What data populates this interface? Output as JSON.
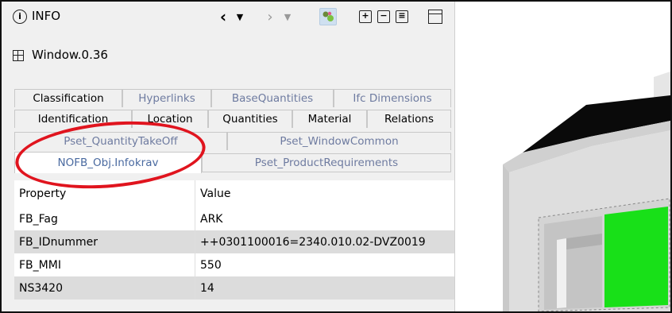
{
  "panel": {
    "title": "INFO",
    "info_icon_glyph": "i",
    "object_name": "Window.0.36"
  },
  "toolbar": {
    "back_glyph": "‹",
    "back_dropdown_glyph": "▼",
    "forward_glyph": "›",
    "forward_dropdown_glyph": "▼",
    "add_glyph": "+",
    "remove_glyph": "−",
    "list_glyph": "≡",
    "icons": [
      "chevron-left-icon",
      "dropdown-icon",
      "chevron-right-icon",
      "dropdown-icon",
      "filter-icon",
      "add-icon",
      "remove-icon",
      "list-icon",
      "window-icon"
    ]
  },
  "tabs": {
    "row1": [
      "Classification",
      "Hyperlinks",
      "BaseQuantities",
      "Ifc Dimensions"
    ],
    "row2": [
      "Identification",
      "Location",
      "Quantities",
      "Material",
      "Relations"
    ],
    "row3": [
      "Pset_QuantityTakeOff",
      "Pset_WindowCommon"
    ],
    "row4": [
      "NOFB_Obj.Infokrav",
      "Pset_ProductRequirements"
    ]
  },
  "table": {
    "headers": [
      "Property",
      "Value"
    ],
    "rows": [
      [
        "FB_Fag",
        "ARK"
      ],
      [
        "FB_IDnummer",
        "++0301100016=2340.010.02-DVZ0019"
      ],
      [
        "FB_MMI",
        "550"
      ],
      [
        "NS3420",
        "14"
      ]
    ]
  },
  "colors": {
    "highlight": "#e0141e",
    "accent": "#4a6aa0",
    "selection_green": "#18e018",
    "panel_bg": "#f0f0f0"
  }
}
